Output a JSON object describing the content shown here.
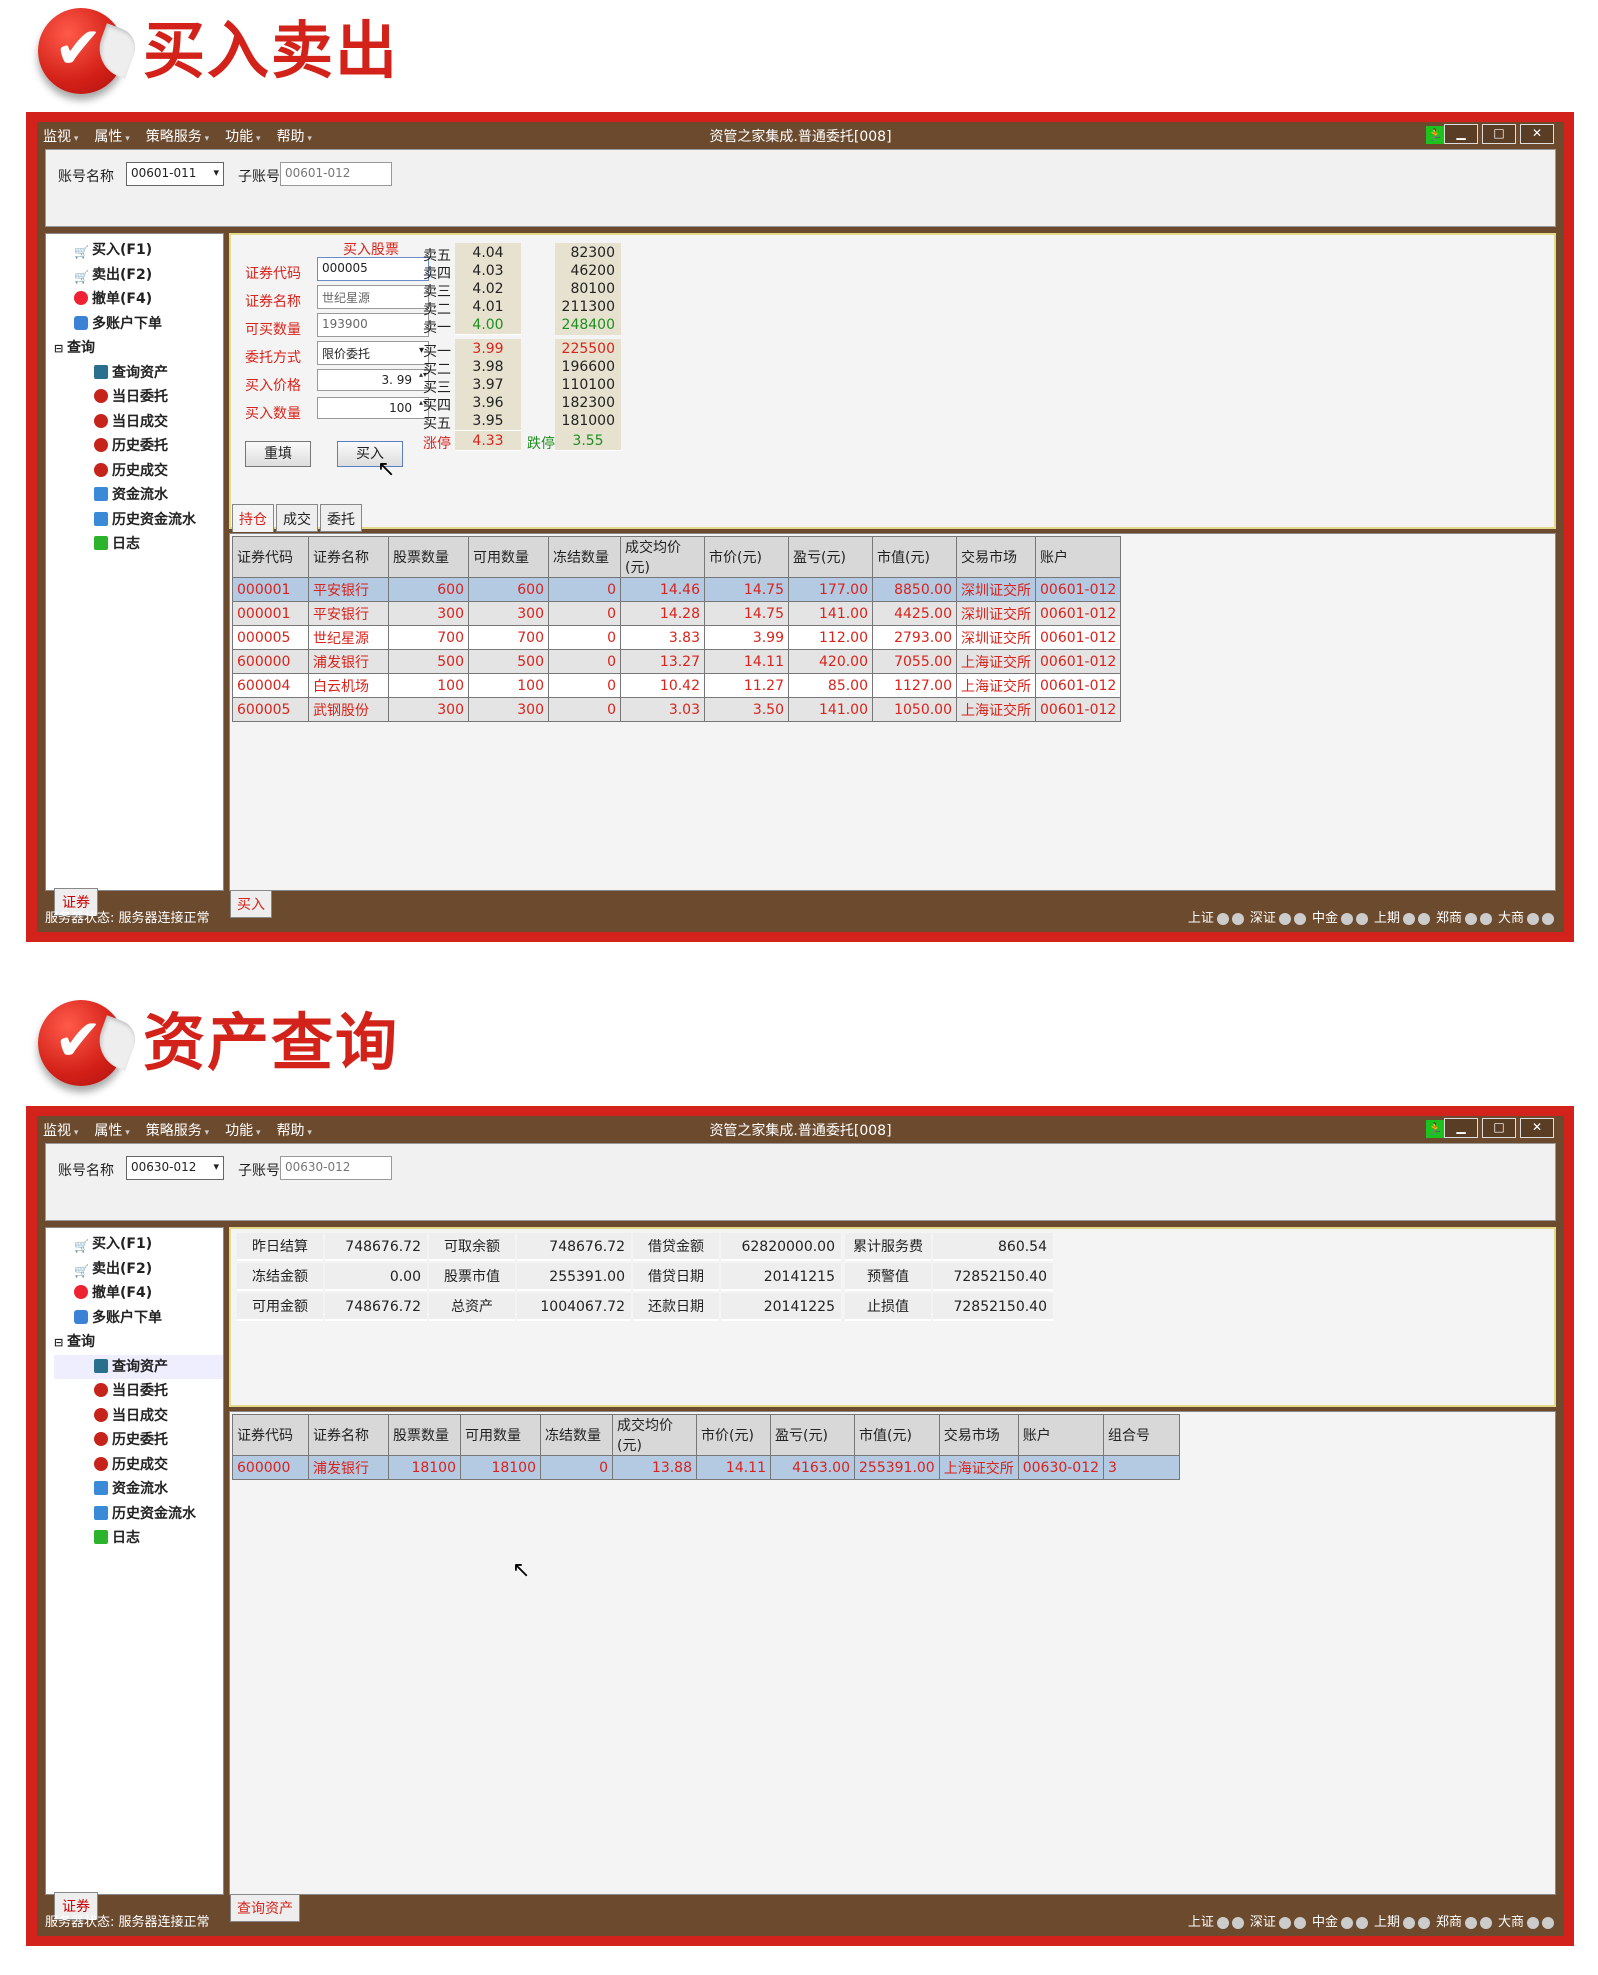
{
  "sections": [
    {
      "heading": "买入卖出",
      "window": {
        "menu": [
          "监视",
          "属性",
          "策略服务",
          "功能",
          "帮助"
        ],
        "title": "资管之家集成.普通委托[008]",
        "controls": [
          "▁",
          "□",
          "✕"
        ],
        "account_label": "账号名称",
        "account_value": "00601-011",
        "subaccount_label": "子账号",
        "subaccount_value": "00601-012",
        "tree": [
          {
            "label": "买入(F1)",
            "icon": "cart-icon"
          },
          {
            "label": "卖出(F2)",
            "icon": "cart-icon"
          },
          {
            "label": "撤单(F4)",
            "icon": "stop-icon"
          },
          {
            "label": "多账户下单",
            "icon": "multi-icon"
          },
          {
            "label": "查询",
            "icon": "minus-icon"
          },
          {
            "label": "查询资产",
            "icon": "database-icon"
          },
          {
            "label": "当日委托",
            "icon": "record-icon"
          },
          {
            "label": "当日成交",
            "icon": "record-icon"
          },
          {
            "label": "历史委托",
            "icon": "record-icon"
          },
          {
            "label": "历史成交",
            "icon": "record-icon"
          },
          {
            "label": "资金流水",
            "icon": "flow-icon"
          },
          {
            "label": "历史资金流水",
            "icon": "flow-icon"
          },
          {
            "label": "日志",
            "icon": "log-icon"
          }
        ],
        "left_tab": "证券",
        "bottom_tab": "买入",
        "status": "服务器状态:  服务器连接正常",
        "markets": [
          "上证",
          "深证",
          "中金",
          "上期",
          "郑商",
          "大商"
        ],
        "order_form": {
          "title": "买入股票",
          "code_label": "证券代码",
          "code_value": "000005",
          "name_label": "证券名称",
          "name_value": "世纪星源",
          "avail_label": "可买数量",
          "avail_value": "193900",
          "method_label": "委托方式",
          "method_value": "限价委托",
          "price_label": "买入价格",
          "price_value": "3. 99",
          "qty_label": "买入数量",
          "qty_value": "100",
          "reset_button": "重填",
          "buy_button": "买入"
        },
        "order_book": {
          "sells": [
            {
              "label": "卖五",
              "price": "4.04",
              "vol": "82300",
              "color": "k"
            },
            {
              "label": "卖四",
              "price": "4.03",
              "vol": "46200",
              "color": "k"
            },
            {
              "label": "卖三",
              "price": "4.02",
              "vol": "80100",
              "color": "k"
            },
            {
              "label": "卖二",
              "price": "4.01",
              "vol": "211300",
              "color": "k"
            },
            {
              "label": "卖一",
              "price": "4.00",
              "vol": "248400",
              "color": "g"
            }
          ],
          "buys": [
            {
              "label": "买一",
              "price": "3.99",
              "vol": "225500",
              "color": "r"
            },
            {
              "label": "买二",
              "price": "3.98",
              "vol": "196600",
              "color": "k"
            },
            {
              "label": "买三",
              "price": "3.97",
              "vol": "110100",
              "color": "k"
            },
            {
              "label": "买四",
              "price": "3.96",
              "vol": "182300",
              "color": "k"
            },
            {
              "label": "买五",
              "price": "3.95",
              "vol": "181000",
              "color": "k"
            }
          ],
          "limit_up_label": "涨停",
          "limit_up": "4.33",
          "limit_down_label": "跌停",
          "limit_down": "3.55"
        },
        "grid_tabs": [
          "持仓",
          "成交",
          "委托"
        ],
        "grid_headers": [
          "证券代码",
          "证券名称",
          "股票数量",
          "可用数量",
          "冻结数量",
          "成交均价(元)",
          "市价(元)",
          "盈亏(元)",
          "市值(元)",
          "交易市场",
          "账户"
        ],
        "grid_rows": [
          [
            "000001",
            "平安银行",
            "600",
            "600",
            "0",
            "14.46",
            "14.75",
            "177.00",
            "8850.00",
            "深圳证交所",
            "00601-012"
          ],
          [
            "000001",
            "平安银行",
            "300",
            "300",
            "0",
            "14.28",
            "14.75",
            "141.00",
            "4425.00",
            "深圳证交所",
            "00601-012"
          ],
          [
            "000005",
            "世纪星源",
            "700",
            "700",
            "0",
            "3.83",
            "3.99",
            "112.00",
            "2793.00",
            "深圳证交所",
            "00601-012"
          ],
          [
            "600000",
            "浦发银行",
            "500",
            "500",
            "0",
            "13.27",
            "14.11",
            "420.00",
            "7055.00",
            "上海证交所",
            "00601-012"
          ],
          [
            "600004",
            "白云机场",
            "100",
            "100",
            "0",
            "10.42",
            "11.27",
            "85.00",
            "1127.00",
            "上海证交所",
            "00601-012"
          ],
          [
            "600005",
            "武钢股份",
            "300",
            "300",
            "0",
            "3.03",
            "3.50",
            "141.00",
            "1050.00",
            "上海证交所",
            "00601-012"
          ]
        ]
      }
    },
    {
      "heading": "资产查询",
      "window": {
        "menu": [
          "监视",
          "属性",
          "策略服务",
          "功能",
          "帮助"
        ],
        "title": "资管之家集成.普通委托[008]",
        "controls": [
          "▁",
          "□",
          "✕"
        ],
        "account_label": "账号名称",
        "account_value": "00630-012",
        "subaccount_label": "子账号",
        "subaccount_value": "00630-012",
        "left_tab": "证券",
        "bottom_tab": "查询资产",
        "status": "服务器状态:  服务器连接正常",
        "assets": [
          [
            "昨日结算",
            "748676.72",
            "可取余额",
            "748676.72",
            "借贷金额",
            "62820000.00",
            "累计服务费",
            "860.54"
          ],
          [
            "冻结金额",
            "0.00",
            "股票市值",
            "255391.00",
            "借贷日期",
            "20141215",
            "预警值",
            "72852150.40"
          ],
          [
            "可用金额",
            "748676.72",
            "总资产",
            "1004067.72",
            "还款日期",
            "20141225",
            "止损值",
            "72852150.40"
          ]
        ],
        "grid_headers": [
          "证券代码",
          "证券名称",
          "股票数量",
          "可用数量",
          "冻结数量",
          "成交均价(元)",
          "市价(元)",
          "盈亏(元)",
          "市值(元)",
          "交易市场",
          "账户",
          "组合号"
        ],
        "grid_rows": [
          [
            "600000",
            "浦发银行",
            "18100",
            "18100",
            "0",
            "13.88",
            "14.11",
            "4163.00",
            "255391.00",
            "上海证交所",
            "00630-012",
            "3"
          ]
        ]
      }
    }
  ]
}
